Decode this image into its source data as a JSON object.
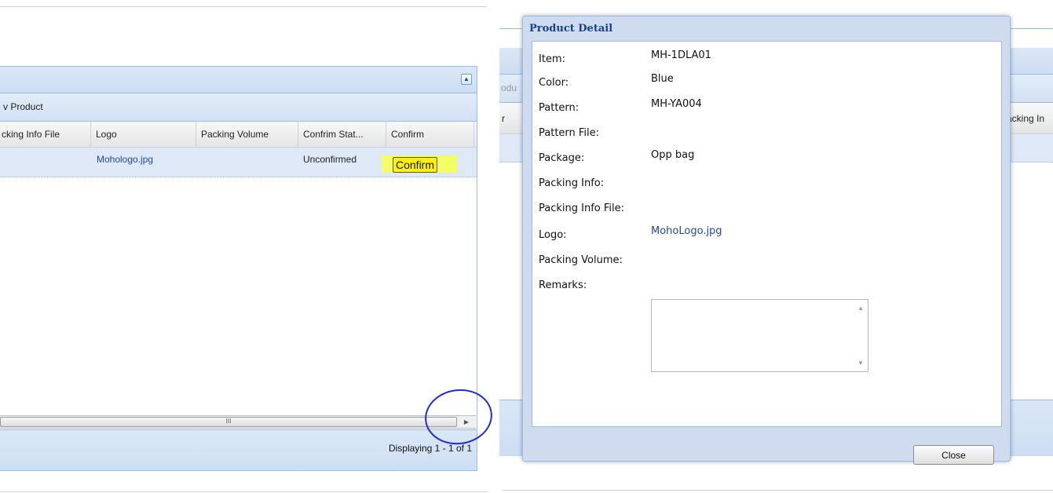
{
  "left_panel": {
    "toolbar_label": "v Product",
    "columns": [
      "cking Info File",
      "Logo",
      "Packing Volume",
      "Confrim Stat...",
      "Confirm"
    ],
    "row": {
      "logo": "Mohologo.jpg",
      "status": "Unconfirmed",
      "confirm_label": "Confirm"
    },
    "scroll_grip": "III",
    "footer_text": "Displaying 1 - 1 of 1"
  },
  "background_panel": {
    "toolbar_fragment": "odu",
    "header_fragment_left": "r",
    "header_fragment_right": "acking In"
  },
  "modal": {
    "title": "Product Detail",
    "fields": [
      {
        "label": "Item:",
        "value": "MH-1DLA01"
      },
      {
        "label": "Color:",
        "value": "Blue"
      },
      {
        "label": "Pattern:",
        "value": "MH-YA004"
      },
      {
        "label": "Pattern File:",
        "value": ""
      },
      {
        "label": "Package:",
        "value": "Opp bag"
      },
      {
        "label": "Packing Info:",
        "value": ""
      },
      {
        "label": "Packing Info File:",
        "value": ""
      },
      {
        "label": "Logo:",
        "value": "MohoLogo.jpg"
      },
      {
        "label": "Packing Volume:",
        "value": ""
      },
      {
        "label": "Remarks:",
        "value": ""
      }
    ],
    "close_label": "Close"
  },
  "colors": {
    "panel_border": "#99bbe8",
    "title_blue": "#15428b",
    "link_blue": "#1f4a99",
    "highlight": "#fff200",
    "annotation_circle": "#1d2bdc"
  },
  "icons": {
    "collapse": "collapse-up-icon",
    "scroll_right": "arrow-right-icon",
    "scroll_up": "arrow-up-icon",
    "scroll_down": "arrow-down-icon"
  }
}
